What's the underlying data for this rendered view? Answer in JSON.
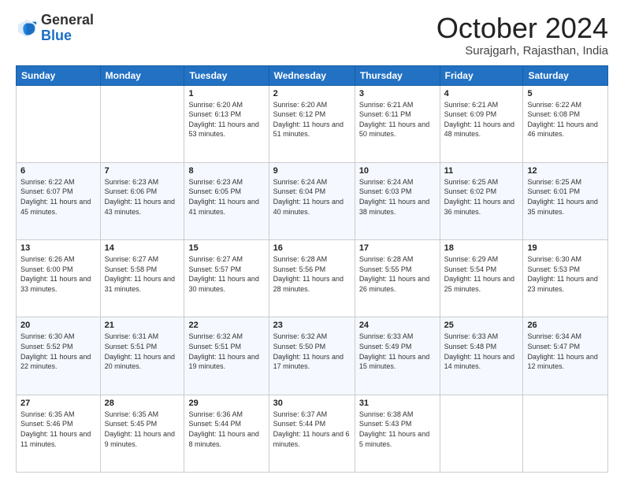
{
  "logo": {
    "general": "General",
    "blue": "Blue"
  },
  "header": {
    "month": "October 2024",
    "location": "Surajgarh, Rajasthan, India"
  },
  "weekdays": [
    "Sunday",
    "Monday",
    "Tuesday",
    "Wednesday",
    "Thursday",
    "Friday",
    "Saturday"
  ],
  "weeks": [
    [
      {
        "date": "",
        "info": ""
      },
      {
        "date": "",
        "info": ""
      },
      {
        "date": "1",
        "info": "Sunrise: 6:20 AM\nSunset: 6:13 PM\nDaylight: 11 hours and 53 minutes."
      },
      {
        "date": "2",
        "info": "Sunrise: 6:20 AM\nSunset: 6:12 PM\nDaylight: 11 hours and 51 minutes."
      },
      {
        "date": "3",
        "info": "Sunrise: 6:21 AM\nSunset: 6:11 PM\nDaylight: 11 hours and 50 minutes."
      },
      {
        "date": "4",
        "info": "Sunrise: 6:21 AM\nSunset: 6:09 PM\nDaylight: 11 hours and 48 minutes."
      },
      {
        "date": "5",
        "info": "Sunrise: 6:22 AM\nSunset: 6:08 PM\nDaylight: 11 hours and 46 minutes."
      }
    ],
    [
      {
        "date": "6",
        "info": "Sunrise: 6:22 AM\nSunset: 6:07 PM\nDaylight: 11 hours and 45 minutes."
      },
      {
        "date": "7",
        "info": "Sunrise: 6:23 AM\nSunset: 6:06 PM\nDaylight: 11 hours and 43 minutes."
      },
      {
        "date": "8",
        "info": "Sunrise: 6:23 AM\nSunset: 6:05 PM\nDaylight: 11 hours and 41 minutes."
      },
      {
        "date": "9",
        "info": "Sunrise: 6:24 AM\nSunset: 6:04 PM\nDaylight: 11 hours and 40 minutes."
      },
      {
        "date": "10",
        "info": "Sunrise: 6:24 AM\nSunset: 6:03 PM\nDaylight: 11 hours and 38 minutes."
      },
      {
        "date": "11",
        "info": "Sunrise: 6:25 AM\nSunset: 6:02 PM\nDaylight: 11 hours and 36 minutes."
      },
      {
        "date": "12",
        "info": "Sunrise: 6:25 AM\nSunset: 6:01 PM\nDaylight: 11 hours and 35 minutes."
      }
    ],
    [
      {
        "date": "13",
        "info": "Sunrise: 6:26 AM\nSunset: 6:00 PM\nDaylight: 11 hours and 33 minutes."
      },
      {
        "date": "14",
        "info": "Sunrise: 6:27 AM\nSunset: 5:58 PM\nDaylight: 11 hours and 31 minutes."
      },
      {
        "date": "15",
        "info": "Sunrise: 6:27 AM\nSunset: 5:57 PM\nDaylight: 11 hours and 30 minutes."
      },
      {
        "date": "16",
        "info": "Sunrise: 6:28 AM\nSunset: 5:56 PM\nDaylight: 11 hours and 28 minutes."
      },
      {
        "date": "17",
        "info": "Sunrise: 6:28 AM\nSunset: 5:55 PM\nDaylight: 11 hours and 26 minutes."
      },
      {
        "date": "18",
        "info": "Sunrise: 6:29 AM\nSunset: 5:54 PM\nDaylight: 11 hours and 25 minutes."
      },
      {
        "date": "19",
        "info": "Sunrise: 6:30 AM\nSunset: 5:53 PM\nDaylight: 11 hours and 23 minutes."
      }
    ],
    [
      {
        "date": "20",
        "info": "Sunrise: 6:30 AM\nSunset: 5:52 PM\nDaylight: 11 hours and 22 minutes."
      },
      {
        "date": "21",
        "info": "Sunrise: 6:31 AM\nSunset: 5:51 PM\nDaylight: 11 hours and 20 minutes."
      },
      {
        "date": "22",
        "info": "Sunrise: 6:32 AM\nSunset: 5:51 PM\nDaylight: 11 hours and 19 minutes."
      },
      {
        "date": "23",
        "info": "Sunrise: 6:32 AM\nSunset: 5:50 PM\nDaylight: 11 hours and 17 minutes."
      },
      {
        "date": "24",
        "info": "Sunrise: 6:33 AM\nSunset: 5:49 PM\nDaylight: 11 hours and 15 minutes."
      },
      {
        "date": "25",
        "info": "Sunrise: 6:33 AM\nSunset: 5:48 PM\nDaylight: 11 hours and 14 minutes."
      },
      {
        "date": "26",
        "info": "Sunrise: 6:34 AM\nSunset: 5:47 PM\nDaylight: 11 hours and 12 minutes."
      }
    ],
    [
      {
        "date": "27",
        "info": "Sunrise: 6:35 AM\nSunset: 5:46 PM\nDaylight: 11 hours and 11 minutes."
      },
      {
        "date": "28",
        "info": "Sunrise: 6:35 AM\nSunset: 5:45 PM\nDaylight: 11 hours and 9 minutes."
      },
      {
        "date": "29",
        "info": "Sunrise: 6:36 AM\nSunset: 5:44 PM\nDaylight: 11 hours and 8 minutes."
      },
      {
        "date": "30",
        "info": "Sunrise: 6:37 AM\nSunset: 5:44 PM\nDaylight: 11 hours and 6 minutes."
      },
      {
        "date": "31",
        "info": "Sunrise: 6:38 AM\nSunset: 5:43 PM\nDaylight: 11 hours and 5 minutes."
      },
      {
        "date": "",
        "info": ""
      },
      {
        "date": "",
        "info": ""
      }
    ]
  ]
}
